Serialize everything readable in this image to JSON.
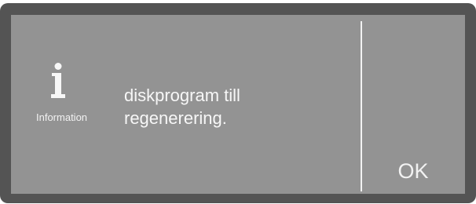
{
  "dialog": {
    "icon": "info-icon",
    "icon_caption": "Information",
    "message_lines": [
      "diskprogram till",
      "regenerering."
    ],
    "ok_label": "OK"
  },
  "colors": {
    "bezel": "#545454",
    "screen": "#939393",
    "text": "#f7f7f7"
  }
}
